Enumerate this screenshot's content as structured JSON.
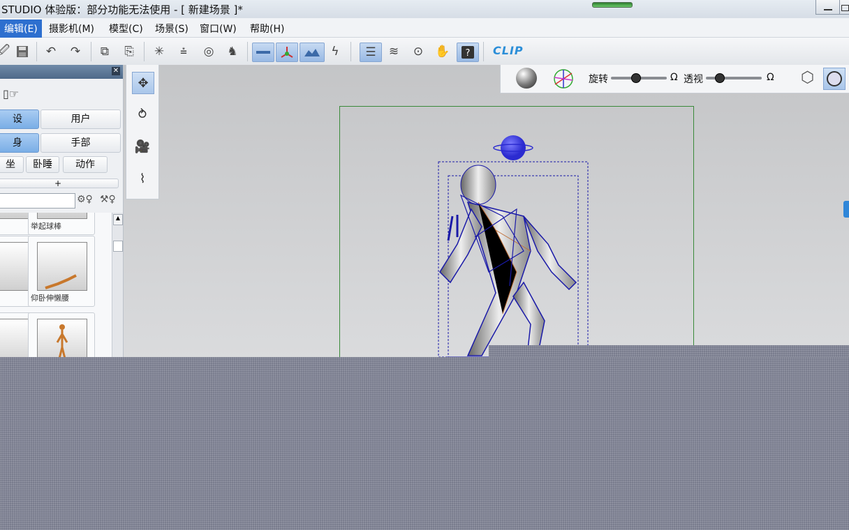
{
  "window": {
    "title": "STUDIO 体验版：部分功能无法使用 - [ 新建场景 ]*"
  },
  "menu": [
    {
      "label": "编辑(E)"
    },
    {
      "label": "摄影机(M)"
    },
    {
      "label": "模型(C)"
    },
    {
      "label": "场景(S)"
    },
    {
      "label": "窗口(W)"
    },
    {
      "label": "帮助(H)"
    }
  ],
  "toolbar": {
    "logo": "CLIP",
    "icons": [
      "open-icon",
      "save-icon",
      "undo-icon",
      "redo-icon",
      "copy-icon",
      "paste-icon",
      "light-icon",
      "ground-icon",
      "target-icon",
      "pose-icon",
      "bone-icon",
      "axis-icon",
      "terrain-icon",
      "pen-icon",
      "list-icon",
      "layers-icon",
      "camera-view-icon",
      "hand-icon",
      "help-icon"
    ]
  },
  "left_panel": {
    "tabs_row1": [
      "设",
      "用户"
    ],
    "tabs_row2": [
      "身",
      "手部"
    ],
    "tabs_row3": [
      "坐",
      "卧睡",
      "动作"
    ],
    "add_label": "+",
    "search_value": "",
    "thumbs": [
      {
        "caption": "举起球棒"
      },
      {
        "caption": ""
      },
      {
        "caption": "仰卧伸懒腰"
      },
      {
        "caption": ""
      },
      {
        "caption": ""
      }
    ]
  },
  "view_bar": {
    "rotate_label": "旋转",
    "perspective_label": "透视",
    "reset_symbol": "Ω",
    "rotate_value": 0.45,
    "perspective_value": 0.25
  },
  "colors": {
    "accent": "#2d6fcf",
    "frame": "#3a8a3a",
    "wire": "#1a1aa8"
  }
}
